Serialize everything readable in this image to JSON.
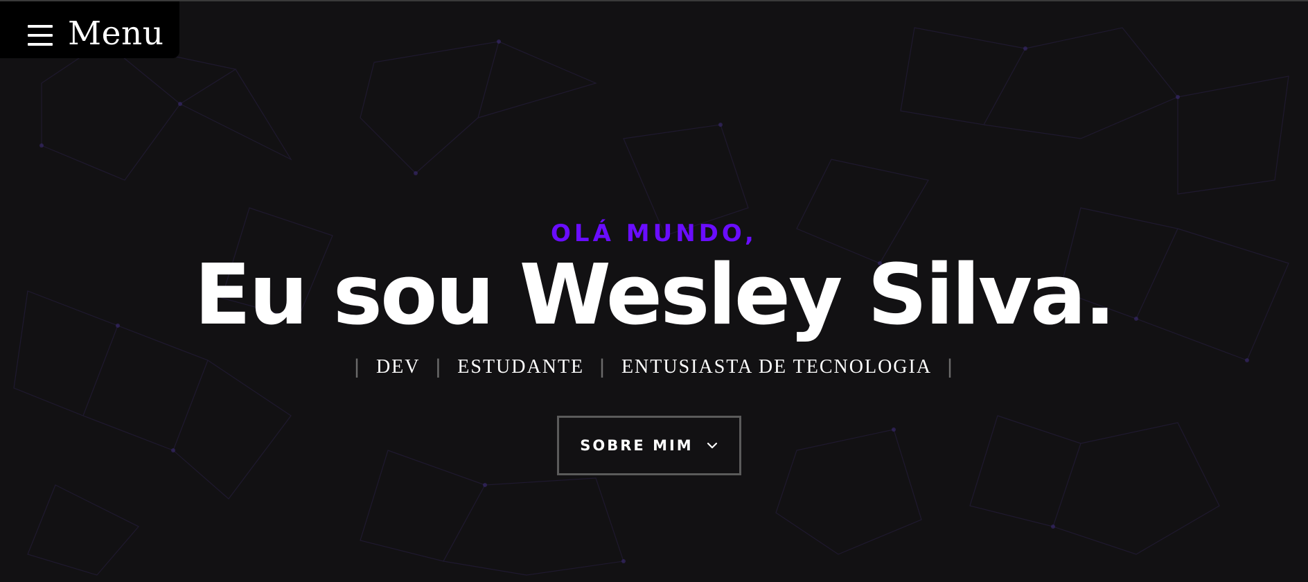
{
  "menu": {
    "label": "Menu",
    "icon": "hamburger-icon"
  },
  "hero": {
    "greeting": "OLÁ MUNDO,",
    "title": "Eu sou Wesley Silva.",
    "roles": [
      "DEV",
      "ESTUDANTE",
      "ENTUSIASTA DE TECNOLOGIA"
    ],
    "separator": "|",
    "cta_label": "SOBRE MIM",
    "cta_icon": "chevron-down-icon"
  },
  "colors": {
    "background": "#121113",
    "accent": "#6a0dff",
    "text": "#ffffff",
    "separator": "#6b6b6b",
    "button_border": "#5b5b5b"
  }
}
